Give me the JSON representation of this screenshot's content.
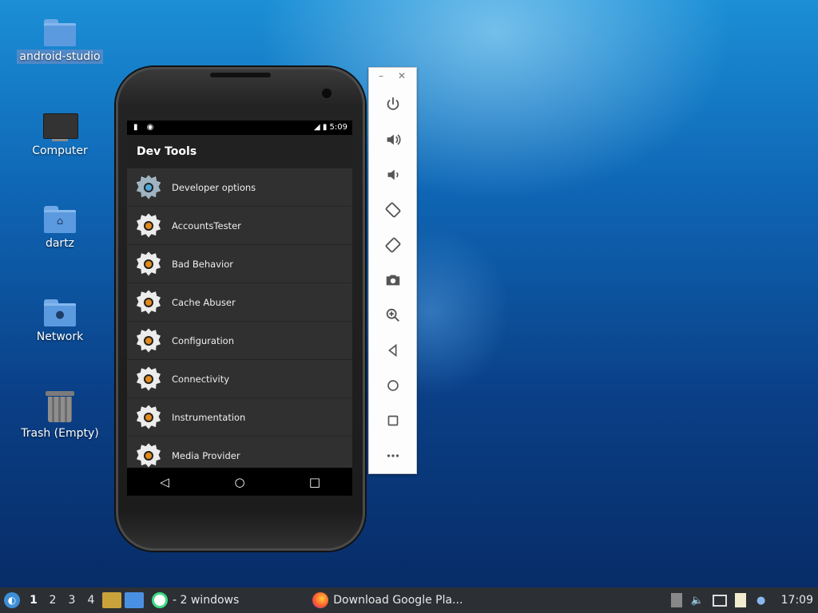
{
  "desktop": {
    "icons": [
      {
        "label": "android-studio"
      },
      {
        "label": "Computer"
      },
      {
        "label": "dartz"
      },
      {
        "label": "Network"
      },
      {
        "label": "Trash (Empty)"
      }
    ]
  },
  "phone": {
    "status_time": "5:09",
    "app_title": "Dev Tools",
    "items": [
      {
        "label": "Developer options"
      },
      {
        "label": "AccountsTester"
      },
      {
        "label": "Bad Behavior"
      },
      {
        "label": "Cache Abuser"
      },
      {
        "label": "Configuration"
      },
      {
        "label": "Connectivity"
      },
      {
        "label": "Instrumentation"
      },
      {
        "label": "Media Provider"
      }
    ]
  },
  "emulator_panel": {
    "buttons": [
      "power-icon",
      "volume-up-icon",
      "volume-down-icon",
      "rotate-left-icon",
      "rotate-right-icon",
      "camera-icon",
      "zoom-icon",
      "back-icon",
      "home-icon",
      "overview-icon",
      "more-icon"
    ]
  },
  "taskbar": {
    "workspaces": [
      "1",
      "2",
      "3",
      "4"
    ],
    "task1_label": "- 2 windows",
    "task2_label": "Download Google Pla...",
    "clock": "17:09"
  }
}
